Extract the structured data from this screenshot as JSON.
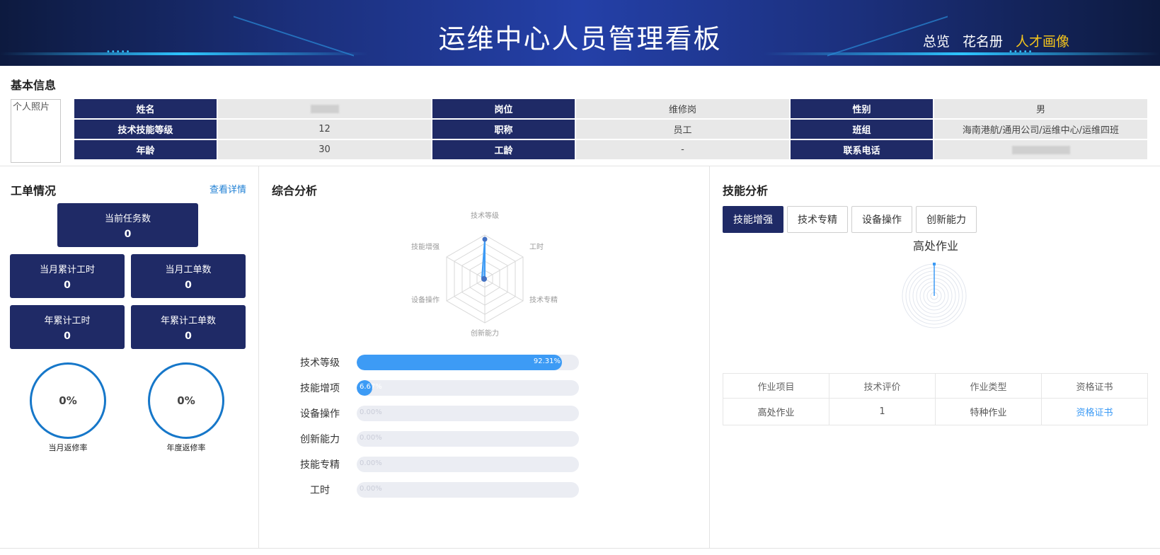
{
  "header": {
    "title": "运维中心人员管理看板",
    "nav": [
      "总览",
      "花名册",
      "人才画像"
    ],
    "active_nav": "人才画像"
  },
  "basic_info": {
    "title": "基本信息",
    "photo_alt": "个人照片",
    "rows": [
      [
        {
          "label": "姓名",
          "value": ""
        },
        {
          "label": "岗位",
          "value": "维修岗"
        },
        {
          "label": "性别",
          "value": "男"
        }
      ],
      [
        {
          "label": "技术技能等级",
          "value": "12"
        },
        {
          "label": "职称",
          "value": "员工"
        },
        {
          "label": "班组",
          "value": "海南港航/通用公司/运维中心/运维四班"
        }
      ],
      [
        {
          "label": "年龄",
          "value": "30"
        },
        {
          "label": "工龄",
          "value": "-"
        },
        {
          "label": "联系电话",
          "value": ""
        }
      ]
    ]
  },
  "work_orders": {
    "title": "工单情况",
    "detail_link": "查看详情",
    "stats": [
      {
        "label": "当前任务数",
        "value": "0"
      },
      {
        "label": "当月累计工时",
        "value": "0"
      },
      {
        "label": "当月工单数",
        "value": "0"
      },
      {
        "label": "年累计工时",
        "value": "0"
      },
      {
        "label": "年累计工单数",
        "value": "0"
      }
    ],
    "rings": [
      {
        "label": "当月返修率",
        "value": "0%"
      },
      {
        "label": "年度返修率",
        "value": "0%"
      }
    ]
  },
  "analysis": {
    "title": "综合分析",
    "radar_axes": [
      "技术等级",
      "工时",
      "技术专精",
      "创新能力",
      "设备操作",
      "技能增强"
    ],
    "bars": [
      {
        "label": "技术等级",
        "value": 92.31,
        "text": "92.31%"
      },
      {
        "label": "技能增项",
        "value": 6.67,
        "text": "6.67%"
      },
      {
        "label": "设备操作",
        "value": 0,
        "text": "0.00%"
      },
      {
        "label": "创新能力",
        "value": 0,
        "text": "0.00%"
      },
      {
        "label": "技能专精",
        "value": 0,
        "text": "0.00%"
      },
      {
        "label": "工时",
        "value": 0,
        "text": "0.00%"
      }
    ]
  },
  "skills": {
    "title": "技能分析",
    "tabs": [
      "技能增强",
      "技术专精",
      "设备操作",
      "创新能力"
    ],
    "active_tab": "技能增强",
    "chart_title": "高处作业",
    "table": {
      "headers": [
        "作业项目",
        "技术评价",
        "作业类型",
        "资格证书"
      ],
      "rows": [
        [
          "高处作业",
          "1",
          "特种作业",
          "资格证书"
        ]
      ]
    }
  },
  "colors": {
    "brand_navy": "#1f2a66",
    "accent_blue": "#3d9bf5",
    "nav_active": "#f5c51c",
    "ring_blue": "#1677c9"
  }
}
